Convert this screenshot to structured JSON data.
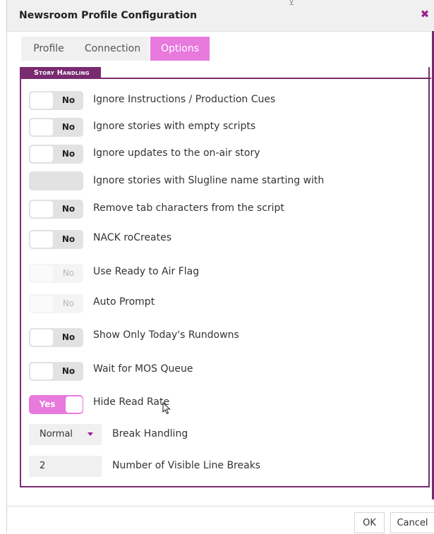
{
  "dialog": {
    "title": "Newsroom Profile Configuration",
    "close_icon": "close-icon"
  },
  "tabs": [
    {
      "label": "Profile",
      "active": false
    },
    {
      "label": "Connection",
      "active": false
    },
    {
      "label": "Options",
      "active": true
    }
  ],
  "section": {
    "title": "Story Handling"
  },
  "options": [
    {
      "label": "Ignore Instructions / Production Cues",
      "value": "No"
    },
    {
      "label": "Ignore stories with empty scripts",
      "value": "No"
    },
    {
      "label": "Ignore updates to the on-air story",
      "value": "No"
    },
    {
      "label": "Ignore stories with Slugline name starting with",
      "value": ""
    },
    {
      "label": "Remove tab characters from the script",
      "value": "No"
    },
    {
      "label": "NACK roCreates",
      "value": "No"
    },
    {
      "label": "Use Ready to Air Flag",
      "value": "No"
    },
    {
      "label": "Auto Prompt",
      "value": "No"
    },
    {
      "label": "Show Only Today's Rundowns",
      "value": "No"
    },
    {
      "label": "Wait for MOS Queue",
      "value": "No"
    },
    {
      "label": "Hide Read Rate",
      "value": "Yes"
    }
  ],
  "break_handling": {
    "label": "Break Handling",
    "value": "Normal"
  },
  "visible_line_breaks": {
    "label": "Number of Visible Line Breaks",
    "value": "2"
  },
  "buttons": {
    "ok": "OK",
    "cancel": "Cancel"
  },
  "colors": {
    "accent": "#e879dd",
    "section": "#7a2b70",
    "close": "#9b1f8f"
  }
}
